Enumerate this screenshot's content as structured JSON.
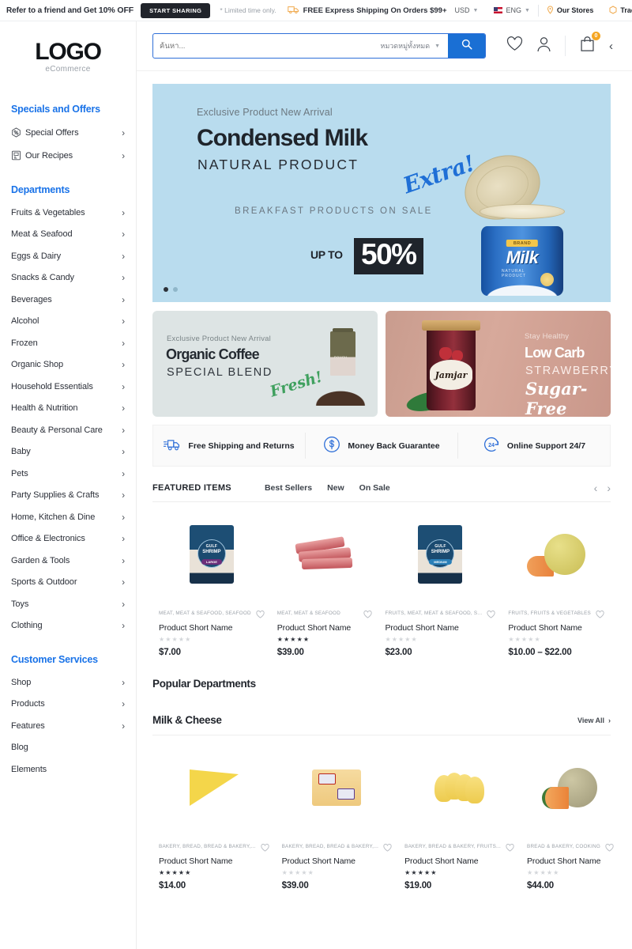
{
  "topbar": {
    "refer_text": "Refer to a friend and Get ",
    "refer_bold": "10% OFF",
    "share_button": "START SHARING",
    "limited": "* Limited time only.",
    "shipping": "FREE Express Shipping On Orders $99+",
    "currency": "USD",
    "language": "ENG",
    "stores": "Our Stores",
    "track": "Track Your Order"
  },
  "logo": {
    "main": "LOGO",
    "sub": "eCommerce"
  },
  "search": {
    "placeholder": "ค้นหา...",
    "category_selected": "หมวดหมู่ทั้งหมด"
  },
  "header_icons": {
    "cart_count": "0"
  },
  "sidebar": {
    "specials_head": "Specials and Offers",
    "specials": [
      {
        "label": "Special Offers",
        "icon": "percent-badge-icon",
        "chevron": true
      },
      {
        "label": "Our Recipes",
        "icon": "recipe-book-icon",
        "chevron": true
      }
    ],
    "departments_head": "Departments",
    "departments": [
      {
        "label": "Fruits & Vegetables",
        "chevron": true
      },
      {
        "label": "Meat & Seafood",
        "chevron": true
      },
      {
        "label": "Eggs & Dairy",
        "chevron": true
      },
      {
        "label": "Snacks & Candy",
        "chevron": true
      },
      {
        "label": "Beverages",
        "chevron": true
      },
      {
        "label": "Alcohol",
        "chevron": true
      },
      {
        "label": "Frozen",
        "chevron": true
      },
      {
        "label": "Organic Shop",
        "chevron": true
      },
      {
        "label": "Household Essentials",
        "chevron": true
      },
      {
        "label": "Health & Nutrition",
        "chevron": true
      },
      {
        "label": "Beauty & Personal Care",
        "chevron": true
      },
      {
        "label": "Baby",
        "chevron": true
      },
      {
        "label": "Pets",
        "chevron": true
      },
      {
        "label": "Party Supplies & Crafts",
        "chevron": true
      },
      {
        "label": "Home, Kitchen & Dine",
        "chevron": true
      },
      {
        "label": "Office & Electronics",
        "chevron": true
      },
      {
        "label": "Garden & Tools",
        "chevron": true
      },
      {
        "label": "Sports & Outdoor",
        "chevron": true
      },
      {
        "label": "Toys",
        "chevron": true
      },
      {
        "label": "Clothing",
        "chevron": true
      }
    ],
    "customer_head": "Customer Services",
    "customer": [
      {
        "label": "Shop",
        "chevron": true
      },
      {
        "label": "Products",
        "chevron": true
      },
      {
        "label": "Features",
        "chevron": true
      },
      {
        "label": "Blog",
        "chevron": false
      },
      {
        "label": "Elements",
        "chevron": false
      }
    ]
  },
  "hero": {
    "kicker": "Exclusive Product New Arrival",
    "title": "Condensed Milk",
    "subtitle": "NATURAL PRODUCT",
    "script": "Extra!",
    "breakfast": "BREAKFAST PRODUCTS ON SALE",
    "upto": "UP TO",
    "discount": "50%",
    "can_brand": "BRAND",
    "can_name": "Milk",
    "can_sub": "NATURAL PRODUCT",
    "bg_color": "#b9dcee"
  },
  "promos": [
    {
      "kicker": "Exclusive Product New Arrival",
      "title": "Organic Coffee",
      "subtitle": "SPECIAL BLEND",
      "script": "Fresh!",
      "pouch_label": "POUCH",
      "bg_color": "#dde4e4"
    },
    {
      "kicker": "Stay Healthy",
      "title": "Low Carb",
      "subtitle": "STRAWBERRY",
      "script": "Sugar-Free",
      "jar_label": "Jamjar",
      "bg_color": "#c99c8e"
    }
  ],
  "services": [
    {
      "label": "Free Shipping and Returns",
      "icon": "delivery-truck-icon"
    },
    {
      "label": "Money Back Guarantee",
      "icon": "dollar-circle-icon"
    },
    {
      "label": "Online Support 24/7",
      "icon": "support-24-icon"
    }
  ],
  "featured": {
    "title": "FEATURED ITEMS",
    "tabs": [
      "Best Sellers",
      "New",
      "On Sale"
    ],
    "products": [
      {
        "categories": "MEAT, MEAT & SEAFOOD, SEAFOOD",
        "name": "Product Short Name",
        "rating": 0,
        "price": "$7.00",
        "art": "shrimp-large"
      },
      {
        "categories": "MEAT, MEAT & SEAFOOD",
        "name": "Product Short Name",
        "rating": 5,
        "price": "$39.00",
        "art": "meat"
      },
      {
        "categories": "FRUITS, MEAT, MEAT & SEAFOOD, S...",
        "name": "Product Short Name",
        "rating": 0,
        "price": "$23.00",
        "art": "shrimp-medium"
      },
      {
        "categories": "FRUITS, FRUITS & VEGETABLES",
        "name": "Product Short Name",
        "rating": 0,
        "price": "$10.00 – $22.00",
        "art": "melon"
      }
    ]
  },
  "popular_departments_title": "Popular Departments",
  "department_section": {
    "title": "Milk & Cheese",
    "view_all": "View All",
    "products": [
      {
        "categories": "BAKERY, BREAD, BREAD & BAKERY,...",
        "name": "Product Short Name",
        "rating": 5,
        "price": "$14.00",
        "art": "cheese-wedge"
      },
      {
        "categories": "BAKERY, BREAD, BREAD & BAKERY,...",
        "name": "Product Short Name",
        "rating": 0,
        "price": "$39.00",
        "art": "cheese-pack"
      },
      {
        "categories": "BAKERY, BREAD & BAKERY, FRUITS...",
        "name": "Product Short Name",
        "rating": 5,
        "price": "$19.00",
        "art": "cheese-slices"
      },
      {
        "categories": "BREAD & BAKERY, COOKING",
        "name": "Product Short Name",
        "rating": 0,
        "price": "$44.00",
        "art": "cantaloupe"
      }
    ]
  },
  "colors": {
    "accent_blue": "#1a73e8",
    "search_blue": "#1a6fd4",
    "badge_orange": "#f5a623"
  }
}
